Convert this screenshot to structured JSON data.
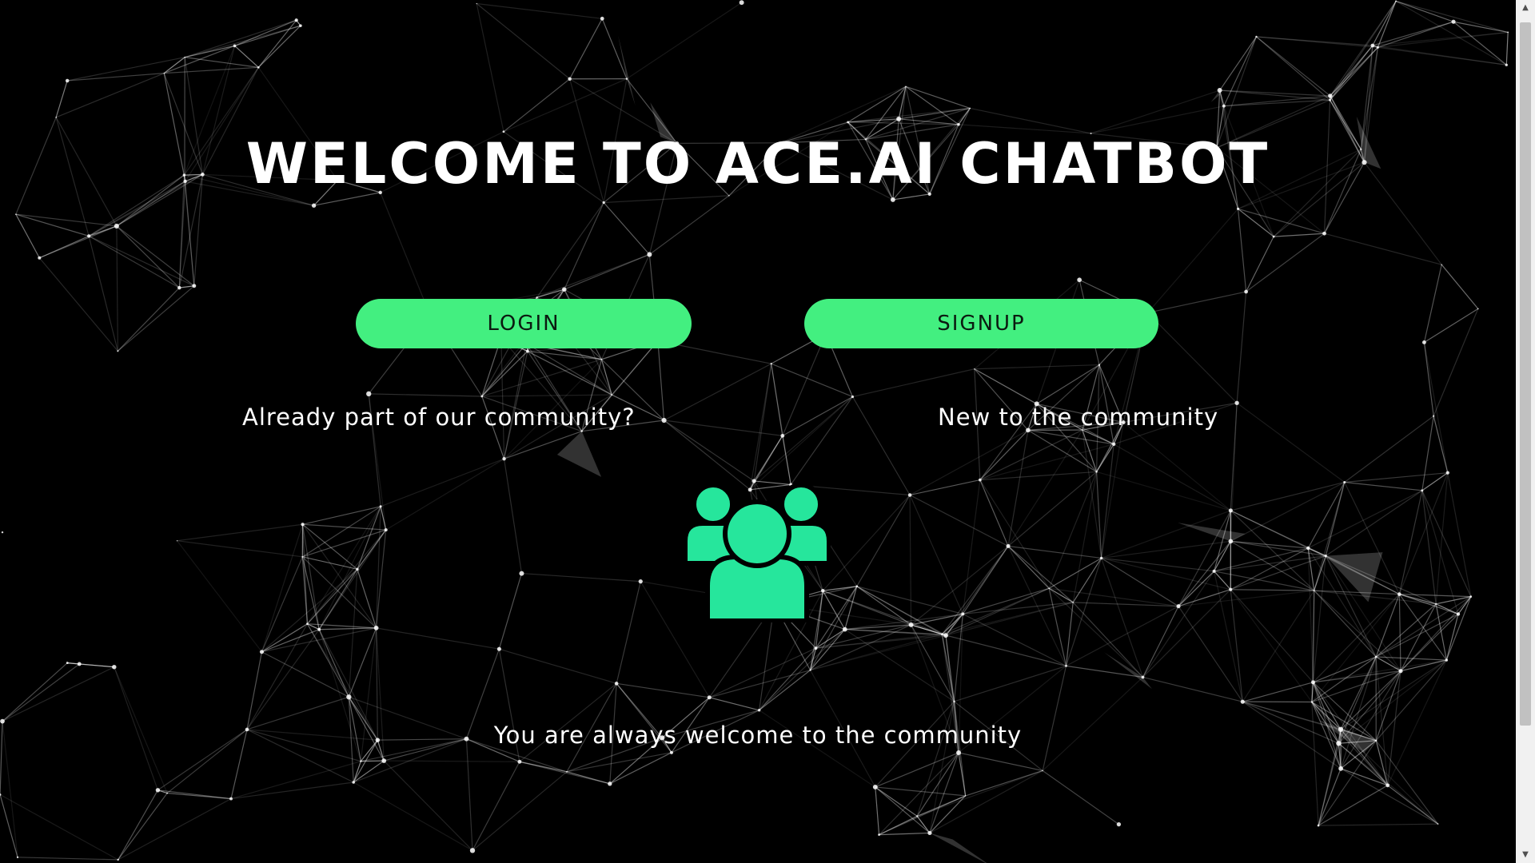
{
  "header": {
    "title": "WELCOME TO ACE.AI CHATBOT"
  },
  "actions": {
    "login_label": "LOGIN",
    "login_caption": "Already part of our community?",
    "signup_label": "SIGNUP",
    "signup_caption": "New to the community"
  },
  "community": {
    "icon": "community-users-icon",
    "tagline": "You are always welcome  to the community"
  },
  "colors": {
    "background": "#000000",
    "accent_button": "#43ef80",
    "icon_green": "#26e69c",
    "text": "#ffffff"
  }
}
